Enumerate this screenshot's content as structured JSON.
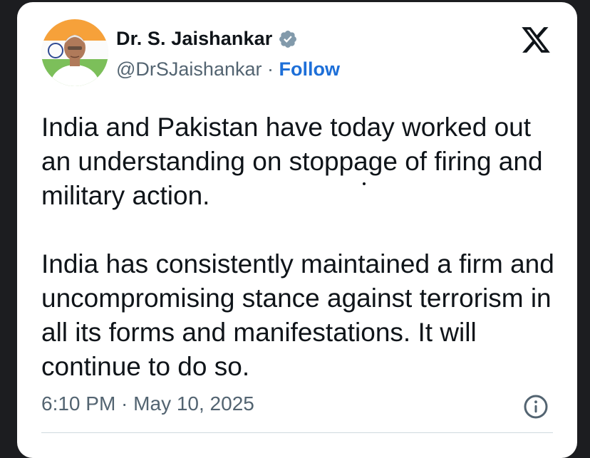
{
  "author": {
    "name": "Dr. S. Jaishankar",
    "handle": "@DrSJaishankar",
    "separator": " · ",
    "follow_label": "Follow",
    "verified": true,
    "verified_color": "#829aab",
    "follow_color": "#1d6fd8"
  },
  "tweet": {
    "paragraphs": [
      "India and Pakistan have today worked out an understanding on stoppage of firing and military action.",
      "India has consistently maintained a firm and uncompromising stance against terrorism in all its forms and manifestations. It will continue to do so."
    ],
    "time": "6:10 PM",
    "meta_separator": " · ",
    "date": "May 10, 2025"
  },
  "icons": {
    "platform": "x-logo-icon",
    "verified": "verified-badge-icon",
    "info": "info-icon"
  }
}
